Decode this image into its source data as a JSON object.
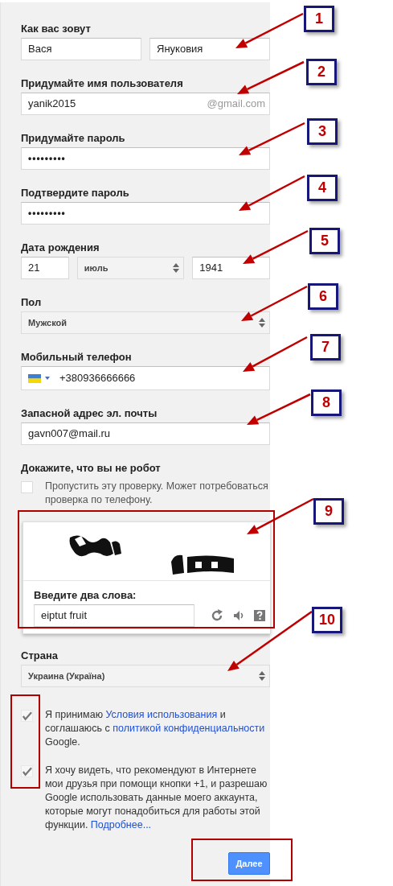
{
  "form": {
    "fields": [
      {
        "kind": "name",
        "label": "Как вас зовут",
        "first": "Вася",
        "last": "Януковия"
      },
      {
        "kind": "text",
        "label": "Придумайте имя пользователя",
        "value": "yanik2015",
        "suffix": "@gmail.com"
      },
      {
        "kind": "password",
        "label": "Придумайте пароль",
        "value": "•••••••••"
      },
      {
        "kind": "password",
        "label": "Подтвердите пароль",
        "value": "•••••••••"
      },
      {
        "kind": "date",
        "label": "Дата рождения",
        "day": "21",
        "month": "июль",
        "year": "1941"
      },
      {
        "kind": "select",
        "label": "Пол",
        "value": "Мужской"
      },
      {
        "kind": "phone",
        "label": "Мобильный телефон",
        "value": "+380936666666"
      },
      {
        "kind": "text",
        "label": "Запасной адрес эл. почты",
        "value": "gavn007@mail.ru"
      },
      {
        "kind": "captcha",
        "label": "Докажите, что вы не робот",
        "skip": {
          "checked": false,
          "text": "Пропустить эту проверку. Может потребоваться проверка по телефону."
        },
        "prompt": "Введите два слова:",
        "value": "eiptut fruit"
      },
      {
        "kind": "select",
        "label": "Страна",
        "value": "Украина (Україна)"
      }
    ],
    "agreements": [
      {
        "checked": true,
        "parts": [
          {
            "kind": "text",
            "text": "Я принимаю "
          },
          {
            "kind": "link",
            "text": "Условия использования"
          },
          {
            "kind": "text",
            "text": " и соглашаюсь с "
          },
          {
            "kind": "link",
            "text": "политикой конфиденциальности"
          },
          {
            "kind": "text",
            "text": " Google."
          }
        ]
      },
      {
        "checked": true,
        "parts": [
          {
            "kind": "text",
            "text": "Я хочу видеть, что рекомендуют в Интернете мои друзья при помощи кнопки +1, и разрешаю Google использовать данные моего аккаунта, которые могут понадобиться для работы этой функции. "
          },
          {
            "kind": "link",
            "text": "Подробнее..."
          }
        ]
      }
    ],
    "submit": "Далее"
  },
  "annotations": [
    {
      "number": "1"
    },
    {
      "number": "2"
    },
    {
      "number": "3"
    },
    {
      "number": "4"
    },
    {
      "number": "5"
    },
    {
      "number": "6"
    },
    {
      "number": "7"
    },
    {
      "number": "8"
    },
    {
      "number": "9"
    },
    {
      "number": "10"
    }
  ]
}
